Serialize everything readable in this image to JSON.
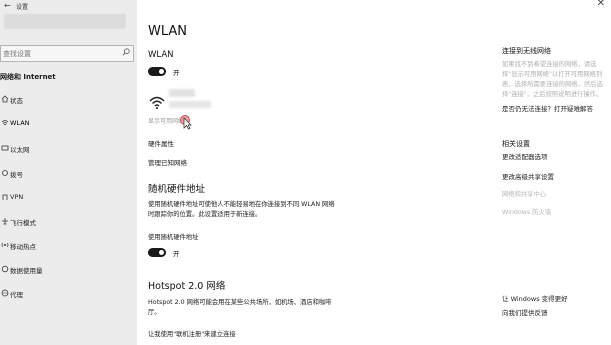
{
  "window": {
    "title": "设置"
  },
  "sidebar": {
    "search_placeholder": "查找设置",
    "section": "网络和 Internet",
    "items": [
      {
        "label": "状态",
        "icon": "home-icon"
      },
      {
        "label": "WLAN",
        "icon": "wifi-icon"
      },
      {
        "label": "以太网",
        "icon": "ethernet-icon"
      },
      {
        "label": "拨号",
        "icon": "dialup-icon"
      },
      {
        "label": "VPN",
        "icon": "vpn-icon"
      },
      {
        "label": "飞行模式",
        "icon": "airplane-icon"
      },
      {
        "label": "移动热点",
        "icon": "hotspot-icon"
      },
      {
        "label": "数据使用量",
        "icon": "data-usage-icon"
      },
      {
        "label": "代理",
        "icon": "globe-icon"
      }
    ]
  },
  "main": {
    "title": "WLAN",
    "wlan_label": "WLAN",
    "wlan_toggle": "开",
    "show_available": "显示可用网络",
    "hardware_props": "硬件属性",
    "manage_known": "管理已知网络",
    "random_hw_title": "随机硬件地址",
    "random_hw_desc_1": "使用随机硬件地址可使他人不能轻易地在你连接到不同 WLAN 网络",
    "random_hw_desc_2": "时跟踪你的位置。此设置适用于新连接。",
    "random_hw_label": "使用随机硬件地址",
    "random_hw_toggle": "开",
    "hotspot_title": "Hotspot 2.0 网络",
    "hotspot_desc_1": "Hotspot 2.0 网络可能会用在某些公共场所，如机场、酒店和咖啡",
    "hotspot_desc_2": "厅。",
    "hotspot_desc_3": "让我使用\"联机注册\"来建立连接"
  },
  "right": {
    "close_glyph": "✕",
    "connect_title": "连接到无线网络",
    "connect_text_1": "如果找不到希望连接的网络，请选",
    "connect_text_2": "择\"显示可用网络\"以打开可用网络列",
    "connect_text_3": "表，选择所需要连接的网络，然后选",
    "connect_text_4": "择\"连接\"，之后按照说明进行操作。",
    "help_link": "是否仍无法连接？打开疑难解答",
    "related_title": "相关设置",
    "adapter_link": "更改适配器选项",
    "sharing_link": "更改高级共享设置",
    "netshare_faint": "网络和共享中心",
    "firewall_faint": "Windows 防火墙",
    "better_title": "让 Windows 变得更好",
    "feedback_link": "向我们提供反馈"
  }
}
